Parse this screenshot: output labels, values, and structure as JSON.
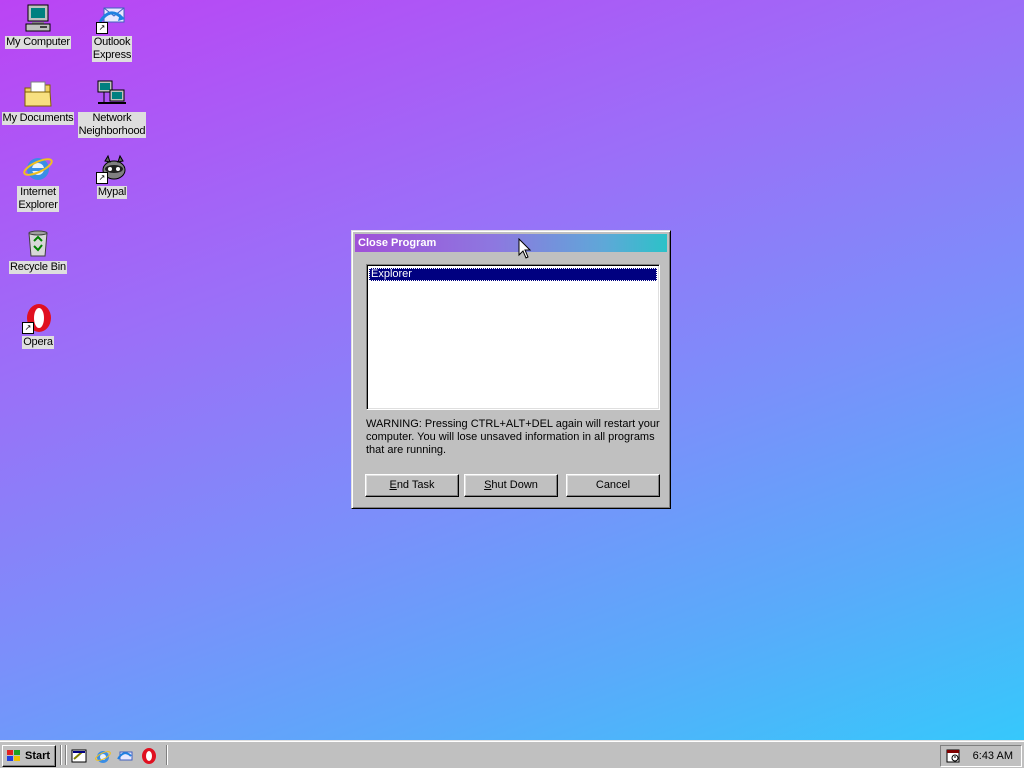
{
  "desktop": {
    "icons": [
      {
        "label": "My Computer",
        "icon": "my-computer-icon"
      },
      {
        "label": "Outlook Express",
        "label_lines": [
          "Outlook",
          "Express"
        ],
        "icon": "outlook-express-icon",
        "shortcut": true
      },
      {
        "label": "My Documents",
        "icon": "my-documents-icon"
      },
      {
        "label": "Network Neighborhood",
        "label_lines": [
          "Network",
          "Neighborhood"
        ],
        "icon": "network-neighborhood-icon"
      },
      {
        "label": "Internet Explorer",
        "label_lines": [
          "Internet",
          "Explorer"
        ],
        "icon": "internet-explorer-icon"
      },
      {
        "label": "Mypal",
        "icon": "mypal-icon",
        "shortcut": true
      },
      {
        "label": "Recycle Bin",
        "icon": "recycle-bin-icon"
      },
      {
        "label": "Opera",
        "icon": "opera-icon",
        "shortcut": true
      }
    ]
  },
  "dialog": {
    "title": "Close Program",
    "list_items": [
      {
        "label": "Explorer",
        "selected": true
      }
    ],
    "warning": "WARNING: Pressing CTRL+ALT+DEL again will restart your computer. You will lose unsaved information in all programs that are running.",
    "buttons": {
      "end_task": "End Task",
      "shut_down": "Shut Down",
      "cancel": "Cancel"
    }
  },
  "taskbar": {
    "start_label": "Start",
    "quick_launch": [
      "show-desktop-icon",
      "internet-explorer-icon",
      "outlook-express-icon",
      "opera-icon"
    ],
    "clock": "6:43 AM"
  },
  "colors": {
    "titlebar_start": "#a050d8",
    "titlebar_end": "#2cc2c8",
    "selection": "#000080",
    "face": "#c0c0c0"
  }
}
